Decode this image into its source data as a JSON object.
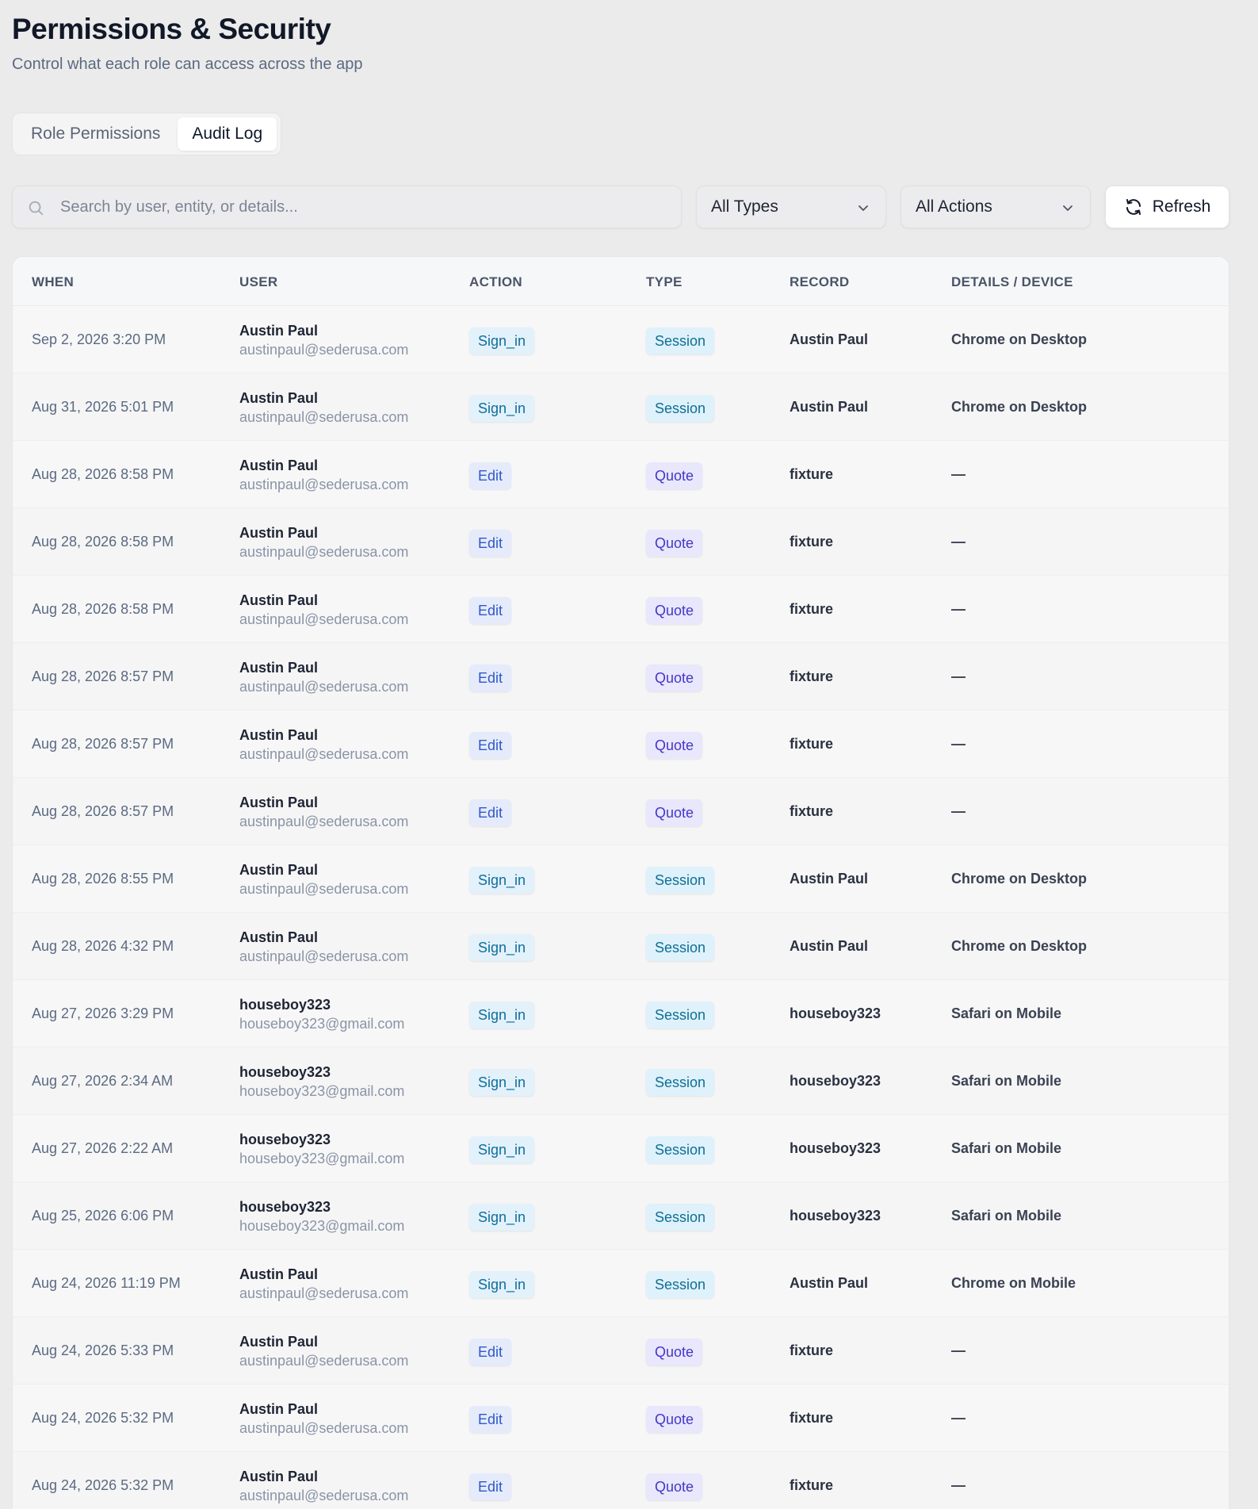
{
  "header": {
    "title": "Permissions & Security",
    "subtitle": "Control what each role can access across the app"
  },
  "tabs": [
    {
      "label": "Role Permissions",
      "active": false
    },
    {
      "label": "Audit Log",
      "active": true
    }
  ],
  "toolbar": {
    "search_placeholder": "Search by user, entity, or details...",
    "search_value": "",
    "type_filter": "All Types",
    "action_filter": "All Actions",
    "refresh_label": "Refresh"
  },
  "table": {
    "columns": [
      "WHEN",
      "USER",
      "ACTION",
      "TYPE",
      "RECORD",
      "DETAILS / DEVICE"
    ],
    "rows": [
      {
        "when": "Sep 2, 2026 3:20 PM",
        "user": "Austin Paul",
        "email": "austinpaul@sederusa.com",
        "action": "Sign_in",
        "type": "Session",
        "record": "Austin Paul",
        "details": "Chrome on Desktop"
      },
      {
        "when": "Aug 31, 2026 5:01 PM",
        "user": "Austin Paul",
        "email": "austinpaul@sederusa.com",
        "action": "Sign_in",
        "type": "Session",
        "record": "Austin Paul",
        "details": "Chrome on Desktop"
      },
      {
        "when": "Aug 28, 2026 8:58 PM",
        "user": "Austin Paul",
        "email": "austinpaul@sederusa.com",
        "action": "Edit",
        "type": "Quote",
        "record": "fixture",
        "details": "—"
      },
      {
        "when": "Aug 28, 2026 8:58 PM",
        "user": "Austin Paul",
        "email": "austinpaul@sederusa.com",
        "action": "Edit",
        "type": "Quote",
        "record": "fixture",
        "details": "—"
      },
      {
        "when": "Aug 28, 2026 8:58 PM",
        "user": "Austin Paul",
        "email": "austinpaul@sederusa.com",
        "action": "Edit",
        "type": "Quote",
        "record": "fixture",
        "details": "—"
      },
      {
        "when": "Aug 28, 2026 8:57 PM",
        "user": "Austin Paul",
        "email": "austinpaul@sederusa.com",
        "action": "Edit",
        "type": "Quote",
        "record": "fixture",
        "details": "—"
      },
      {
        "when": "Aug 28, 2026 8:57 PM",
        "user": "Austin Paul",
        "email": "austinpaul@sederusa.com",
        "action": "Edit",
        "type": "Quote",
        "record": "fixture",
        "details": "—"
      },
      {
        "when": "Aug 28, 2026 8:57 PM",
        "user": "Austin Paul",
        "email": "austinpaul@sederusa.com",
        "action": "Edit",
        "type": "Quote",
        "record": "fixture",
        "details": "—"
      },
      {
        "when": "Aug 28, 2026 8:55 PM",
        "user": "Austin Paul",
        "email": "austinpaul@sederusa.com",
        "action": "Sign_in",
        "type": "Session",
        "record": "Austin Paul",
        "details": "Chrome on Desktop"
      },
      {
        "when": "Aug 28, 2026 4:32 PM",
        "user": "Austin Paul",
        "email": "austinpaul@sederusa.com",
        "action": "Sign_in",
        "type": "Session",
        "record": "Austin Paul",
        "details": "Chrome on Desktop"
      },
      {
        "when": "Aug 27, 2026 3:29 PM",
        "user": "houseboy323",
        "email": "houseboy323@gmail.com",
        "action": "Sign_in",
        "type": "Session",
        "record": "houseboy323",
        "details": "Safari on Mobile"
      },
      {
        "when": "Aug 27, 2026 2:34 AM",
        "user": "houseboy323",
        "email": "houseboy323@gmail.com",
        "action": "Sign_in",
        "type": "Session",
        "record": "houseboy323",
        "details": "Safari on Mobile"
      },
      {
        "when": "Aug 27, 2026 2:22 AM",
        "user": "houseboy323",
        "email": "houseboy323@gmail.com",
        "action": "Sign_in",
        "type": "Session",
        "record": "houseboy323",
        "details": "Safari on Mobile"
      },
      {
        "when": "Aug 25, 2026 6:06 PM",
        "user": "houseboy323",
        "email": "houseboy323@gmail.com",
        "action": "Sign_in",
        "type": "Session",
        "record": "houseboy323",
        "details": "Safari on Mobile"
      },
      {
        "when": "Aug 24, 2026 11:19 PM",
        "user": "Austin Paul",
        "email": "austinpaul@sederusa.com",
        "action": "Sign_in",
        "type": "Session",
        "record": "Austin Paul",
        "details": "Chrome on Mobile"
      },
      {
        "when": "Aug 24, 2026 5:33 PM",
        "user": "Austin Paul",
        "email": "austinpaul@sederusa.com",
        "action": "Edit",
        "type": "Quote",
        "record": "fixture",
        "details": "—"
      },
      {
        "when": "Aug 24, 2026 5:32 PM",
        "user": "Austin Paul",
        "email": "austinpaul@sederusa.com",
        "action": "Edit",
        "type": "Quote",
        "record": "fixture",
        "details": "—"
      },
      {
        "when": "Aug 24, 2026 5:32 PM",
        "user": "Austin Paul",
        "email": "austinpaul@sederusa.com",
        "action": "Edit",
        "type": "Quote",
        "record": "fixture",
        "details": "—"
      }
    ]
  },
  "colors": {
    "background": "#ebebeb",
    "signin_badge": "#e3f1fb",
    "edit_badge": "#e5ebfb",
    "session_badge": "#dff1fa",
    "quote_badge": "#e9e7fb"
  },
  "icons": {
    "search": "search-icon",
    "dropdown": "chevron-down-icon",
    "refresh": "refresh-icon"
  }
}
